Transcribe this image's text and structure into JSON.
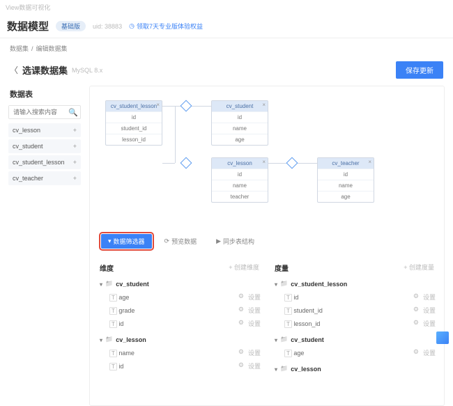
{
  "top_tag": "View数据可视化",
  "header": {
    "title": "数据模型",
    "badge": "基础版",
    "uid_label": "uid: 38883",
    "promo": "领取7天专业版体验权益"
  },
  "crumbs": {
    "a": "数据集",
    "sep": "/",
    "b": "编辑数据集"
  },
  "page": {
    "title": "选课数据集",
    "db": "MySQL 8.x",
    "save": "保存更新"
  },
  "sidebar": {
    "heading": "数据表",
    "search_placeholder": "请输入搜索内容",
    "tables": [
      "cv_lesson",
      "cv_student",
      "cv_student_lesson",
      "cv_teacher"
    ]
  },
  "er": {
    "nodes": [
      {
        "name": "cv_student_lesson",
        "cols": [
          "id",
          "student_id",
          "lesson_id"
        ]
      },
      {
        "name": "cv_student",
        "cols": [
          "id",
          "name",
          "age"
        ]
      },
      {
        "name": "cv_lesson",
        "cols": [
          "id",
          "name",
          "teacher"
        ]
      },
      {
        "name": "cv_teacher",
        "cols": [
          "id",
          "name",
          "age"
        ]
      }
    ]
  },
  "tabs": {
    "filter": "数据筛选器",
    "preview": "预览数据",
    "sync": "同步表结构"
  },
  "dim": {
    "title": "维度",
    "add": "+ 创建维度",
    "groups": [
      {
        "name": "cv_student",
        "fields": [
          "age",
          "grade",
          "id"
        ]
      },
      {
        "name": "cv_lesson",
        "fields": [
          "name",
          "id"
        ]
      }
    ]
  },
  "mea": {
    "title": "度量",
    "add": "+ 创建度量",
    "groups": [
      {
        "name": "cv_student_lesson",
        "fields": [
          "id",
          "student_id",
          "lesson_id"
        ]
      },
      {
        "name": "cv_student",
        "fields": [
          "age"
        ]
      },
      {
        "name": "cv_lesson",
        "fields": []
      }
    ]
  },
  "row_action": "设置"
}
